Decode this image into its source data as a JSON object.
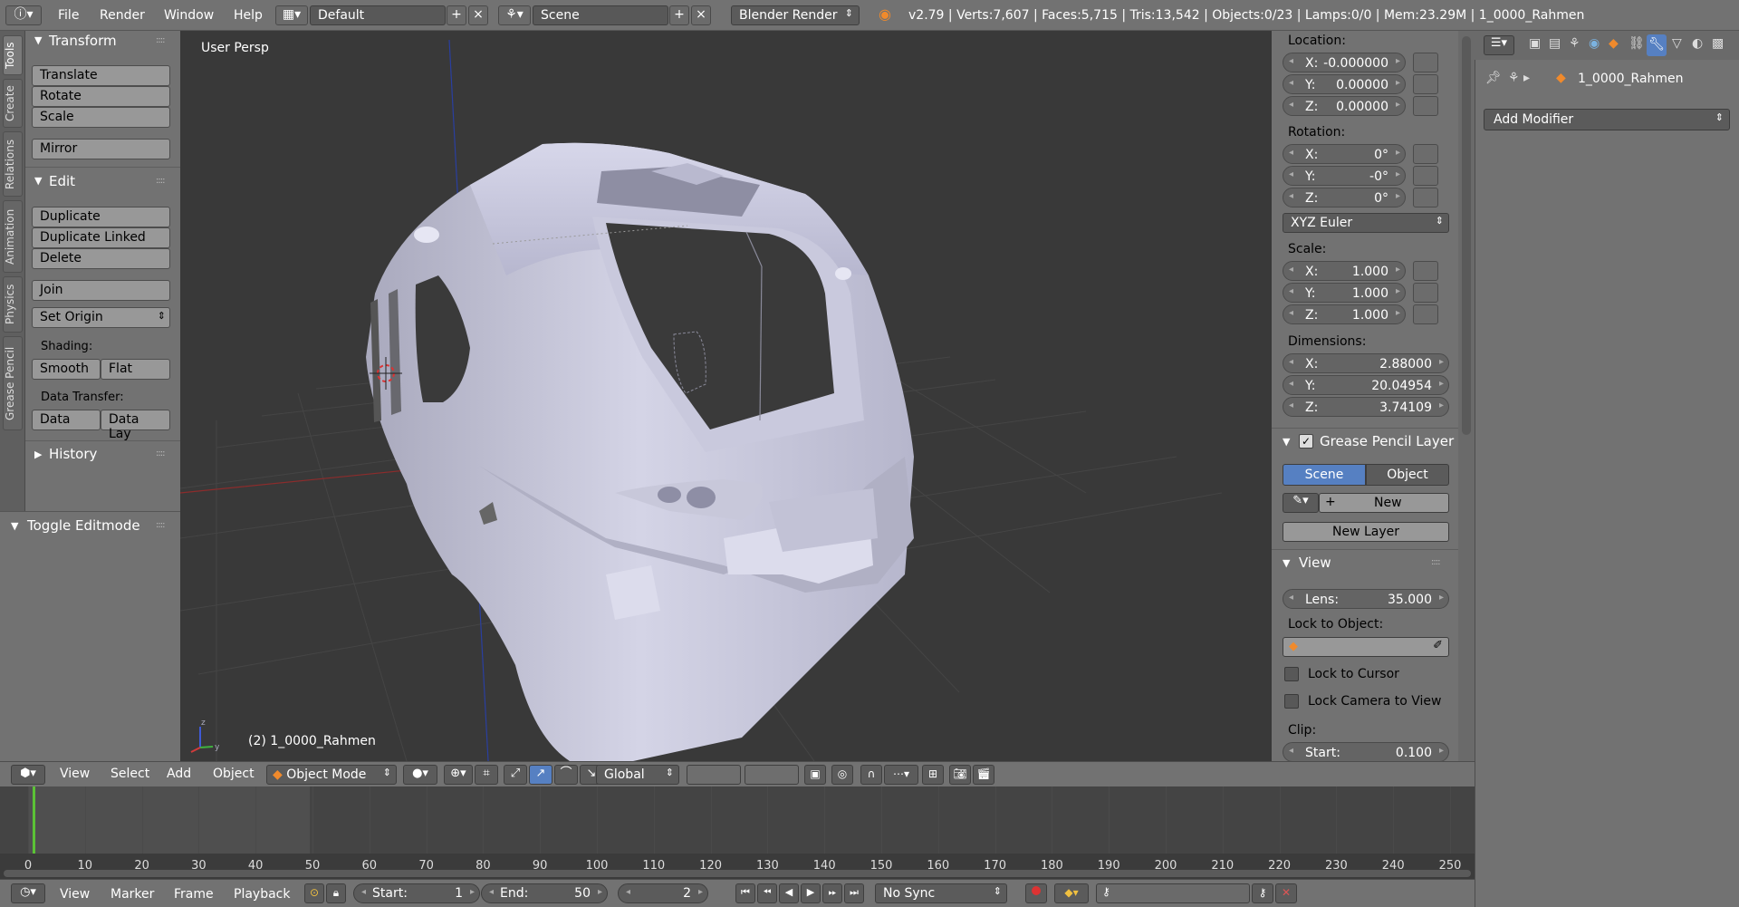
{
  "info_header": {
    "menus": [
      "File",
      "Render",
      "Window",
      "Help"
    ],
    "layout": "Default",
    "scene": "Scene",
    "engine": "Blender Render",
    "stats": "v2.79 | Verts:7,607 | Faces:5,715 | Tris:13,542 | Objects:0/23 | Lamps:0/0 | Mem:23.29M | 1_0000_Rahmen"
  },
  "tool_tabs": [
    "Tools",
    "Create",
    "Relations",
    "Animation",
    "Physics",
    "Grease Pencil"
  ],
  "toolshelf": {
    "transform": {
      "title": "Transform",
      "buttons": [
        "Translate",
        "Rotate",
        "Scale",
        "Mirror"
      ]
    },
    "edit": {
      "title": "Edit",
      "buttons": [
        "Duplicate",
        "Duplicate Linked",
        "Delete",
        "Join",
        "Set Origin"
      ]
    },
    "shading_label": "Shading:",
    "shading": [
      "Smooth",
      "Flat"
    ],
    "data_transfer_label": "Data Transfer:",
    "data_transfer": [
      "Data",
      "Data Lay"
    ],
    "history": "History",
    "operator": "Toggle Editmode"
  },
  "viewport": {
    "view_name": "User Persp",
    "object_name": "(2) 1_0000_Rahmen"
  },
  "npanel": {
    "location_label": "Location:",
    "location": [
      {
        "axis": "X:",
        "value": "-0.000000"
      },
      {
        "axis": "Y:",
        "value": "0.00000"
      },
      {
        "axis": "Z:",
        "value": "0.00000"
      }
    ],
    "rotation_label": "Rotation:",
    "rotation": [
      {
        "axis": "X:",
        "value": "0°"
      },
      {
        "axis": "Y:",
        "value": "-0°"
      },
      {
        "axis": "Z:",
        "value": "0°"
      }
    ],
    "rotation_mode": "XYZ Euler",
    "scale_label": "Scale:",
    "scale": [
      {
        "axis": "X:",
        "value": "1.000"
      },
      {
        "axis": "Y:",
        "value": "1.000"
      },
      {
        "axis": "Z:",
        "value": "1.000"
      }
    ],
    "dimensions_label": "Dimensions:",
    "dimensions": [
      {
        "axis": "X:",
        "value": "2.88000"
      },
      {
        "axis": "Y:",
        "value": "20.04954"
      },
      {
        "axis": "Z:",
        "value": "3.74109"
      }
    ],
    "grease_pencil": {
      "title": "Grease Pencil Layer",
      "scene": "Scene",
      "object": "Object",
      "new": "New",
      "new_layer": "New Layer"
    },
    "view": {
      "title": "View",
      "lens_label": "Lens:",
      "lens_value": "35.000",
      "lock_object_label": "Lock to Object:",
      "lock_cursor": "Lock to Cursor",
      "lock_camera": "Lock Camera to View",
      "clip_label": "Clip:",
      "clip_start_label": "Start:",
      "clip_start_value": "0.100"
    }
  },
  "properties": {
    "object_name": "1_0000_Rahmen",
    "add_modifier": "Add Modifier"
  },
  "view3d_header": {
    "menus": [
      "View",
      "Select",
      "Add",
      "Object"
    ],
    "mode": "Object Mode",
    "orientation": "Global"
  },
  "timeline": {
    "ticks": [
      "0",
      "10",
      "20",
      "30",
      "40",
      "50",
      "60",
      "70",
      "80",
      "90",
      "100",
      "110",
      "120",
      "130",
      "140",
      "150",
      "160",
      "170",
      "180",
      "190",
      "200",
      "210",
      "220",
      "230",
      "240",
      "250"
    ],
    "menus": [
      "View",
      "Marker",
      "Frame",
      "Playback"
    ],
    "start_label": "Start:",
    "start_value": "1",
    "end_label": "End:",
    "end_value": "50",
    "current_frame": "2",
    "sync": "No Sync"
  },
  "colors": {
    "accent": "#5680c2",
    "ui_gray": "#727272",
    "viewport_bg": "#393939",
    "mesh": "#c8c8dc",
    "playhead": "#5bc236"
  }
}
